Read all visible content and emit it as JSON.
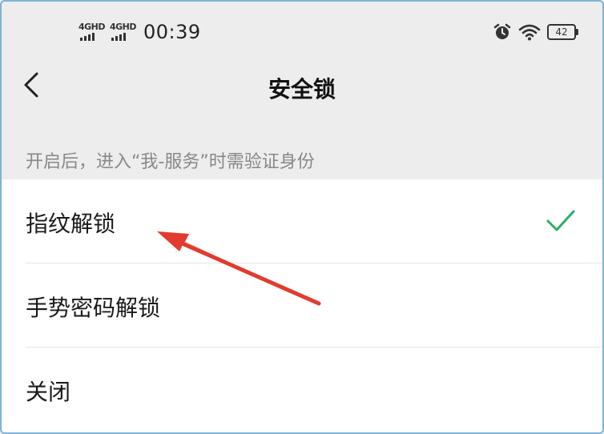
{
  "status_bar": {
    "sim1_network": "4GHD",
    "sim2_network": "4GHD",
    "time": "00:39",
    "battery_level": "42"
  },
  "nav": {
    "title": "安全锁"
  },
  "hint": "开启后，进入“我-服务”时需验证身份",
  "options": [
    {
      "label": "指纹解锁",
      "selected": true
    },
    {
      "label": "手势密码解锁",
      "selected": false
    },
    {
      "label": "关闭",
      "selected": false
    }
  ],
  "colors": {
    "check": "#2bae66",
    "annotation_arrow": "#e23b2e"
  }
}
